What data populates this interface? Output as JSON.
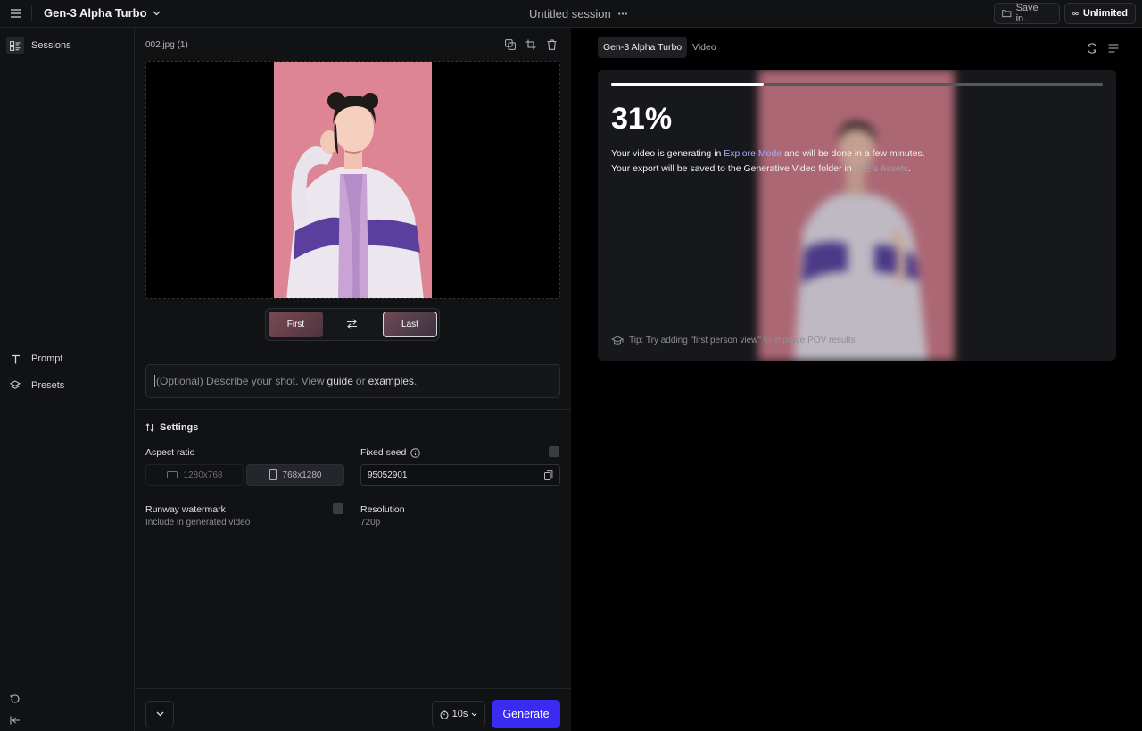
{
  "topbar": {
    "model_name": "Gen-3 Alpha Turbo",
    "session_title": "Untitled session",
    "save_label": "Save in...",
    "plan_label": "Unlimited"
  },
  "sidebar": {
    "items": [
      {
        "label": "Sessions",
        "icon": "sessions-icon"
      },
      {
        "label": "Prompt",
        "icon": "text-icon"
      },
      {
        "label": "Presets",
        "icon": "layers-icon"
      }
    ]
  },
  "editor": {
    "file_name": "002.jpg (1)",
    "frame_first": "First",
    "frame_last": "Last",
    "prompt": {
      "placeholder_start": "(Optional) Describe your shot. View",
      "guide_link": "guide",
      "or_text": "or",
      "examples_link": "examples",
      "placeholder_end": "."
    },
    "settings": {
      "title": "Settings",
      "aspect_ratio_label": "Aspect ratio",
      "aspect_options": [
        "1280x768",
        "768x1280"
      ],
      "aspect_selected": "768x1280",
      "fixed_seed_label": "Fixed seed",
      "seed_value": "95052901",
      "watermark_label": "Runway watermark",
      "watermark_sub": "Include in generated video",
      "resolution_label": "Resolution",
      "resolution_value": "720p"
    },
    "footer": {
      "duration": "10s",
      "generate_label": "Generate"
    }
  },
  "output": {
    "tabs": [
      "Gen-3 Alpha Turbo",
      "Video"
    ],
    "progress_fraction": 0.31,
    "percent_label": "31%",
    "line1_a": "Your video is generating in",
    "line1_link": "Explore Mode",
    "line1_b": "and will be done in a few minutes.",
    "line2_a": "Your export will be saved to the Generative Video folder in",
    "line2_link": "성민's Assets",
    "line2_b": ".",
    "tip": "Tip: Try adding \"first person view\" to improve POV results."
  },
  "colors": {
    "accent": "#3a2bf0",
    "background": "#111214",
    "output_bg": "#000000",
    "photo_backdrop": "#e08a98"
  }
}
